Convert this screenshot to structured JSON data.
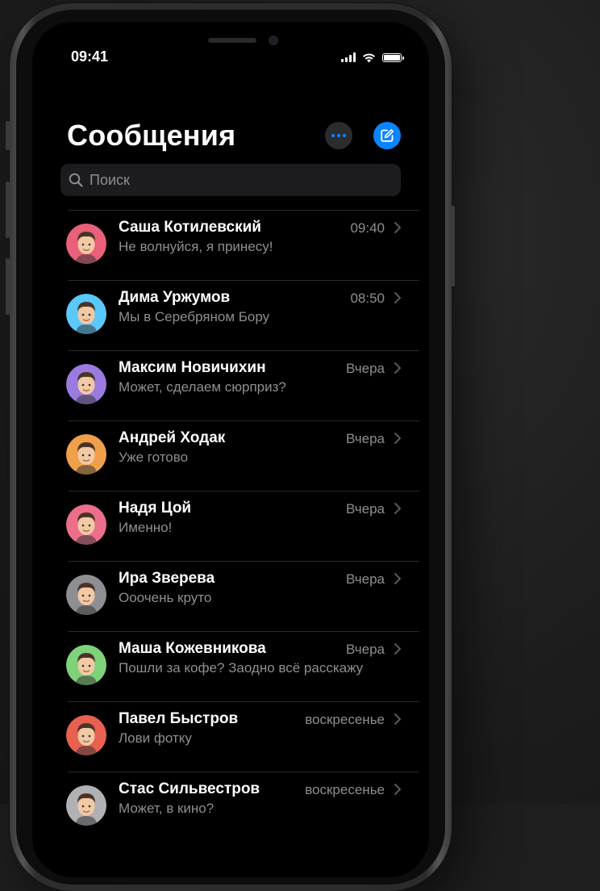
{
  "status_bar": {
    "time": "09:41"
  },
  "header": {
    "title": "Сообщения"
  },
  "search": {
    "placeholder": "Поиск"
  },
  "colors": {
    "accent": "#0a84ff",
    "background": "#000000",
    "secondary_text": "#8e8e93"
  },
  "conversations": [
    {
      "name": "Саша Котилевский",
      "message": "Не волнуйся, я принесу!",
      "time": "09:40",
      "avatar_color": "#e8607a",
      "avatar_icon": "memoji-glasses-man"
    },
    {
      "name": "Дима Уржумов",
      "message": "Мы в Серебряном Бору",
      "time": "08:50",
      "avatar_color": "#5ac8fa",
      "avatar_icon": "memoji-man"
    },
    {
      "name": "Максим Новичихин",
      "message": "Может, сделаем сюрприз?",
      "time": "Вчера",
      "avatar_color": "#9b7be0",
      "avatar_icon": "memoji-bearded-man"
    },
    {
      "name": "Андрей Ходак",
      "message": "Уже готово",
      "time": "Вчера",
      "avatar_color": "#f0a04b",
      "avatar_icon": "memoji-sunglasses-man"
    },
    {
      "name": "Надя Цой",
      "message": "Именно!",
      "time": "Вчера",
      "avatar_color": "#ec6f8a",
      "avatar_icon": "memoji-woman"
    },
    {
      "name": "Ира Зверева",
      "message": "Ооочень круто",
      "time": "Вчера",
      "avatar_color": "#8e8e93",
      "avatar_icon": "memoji-lion"
    },
    {
      "name": "Маша Кожевникова",
      "message": "Пошли за кофе? Заодно всё расскажу",
      "time": "Вчера",
      "avatar_color": "#7ed37a",
      "avatar_icon": "memoji-blonde-woman"
    },
    {
      "name": "Павел Быстров",
      "message": "Лови фотку",
      "time": "воскресенье",
      "avatar_color": "#e8604f",
      "avatar_icon": "memoji-man-dark-hair"
    },
    {
      "name": "Стас Сильвестров",
      "message": "Может, в кино?",
      "time": "воскресенье",
      "avatar_color": "#b0b0b5",
      "avatar_icon": "memoji-octopus"
    }
  ]
}
